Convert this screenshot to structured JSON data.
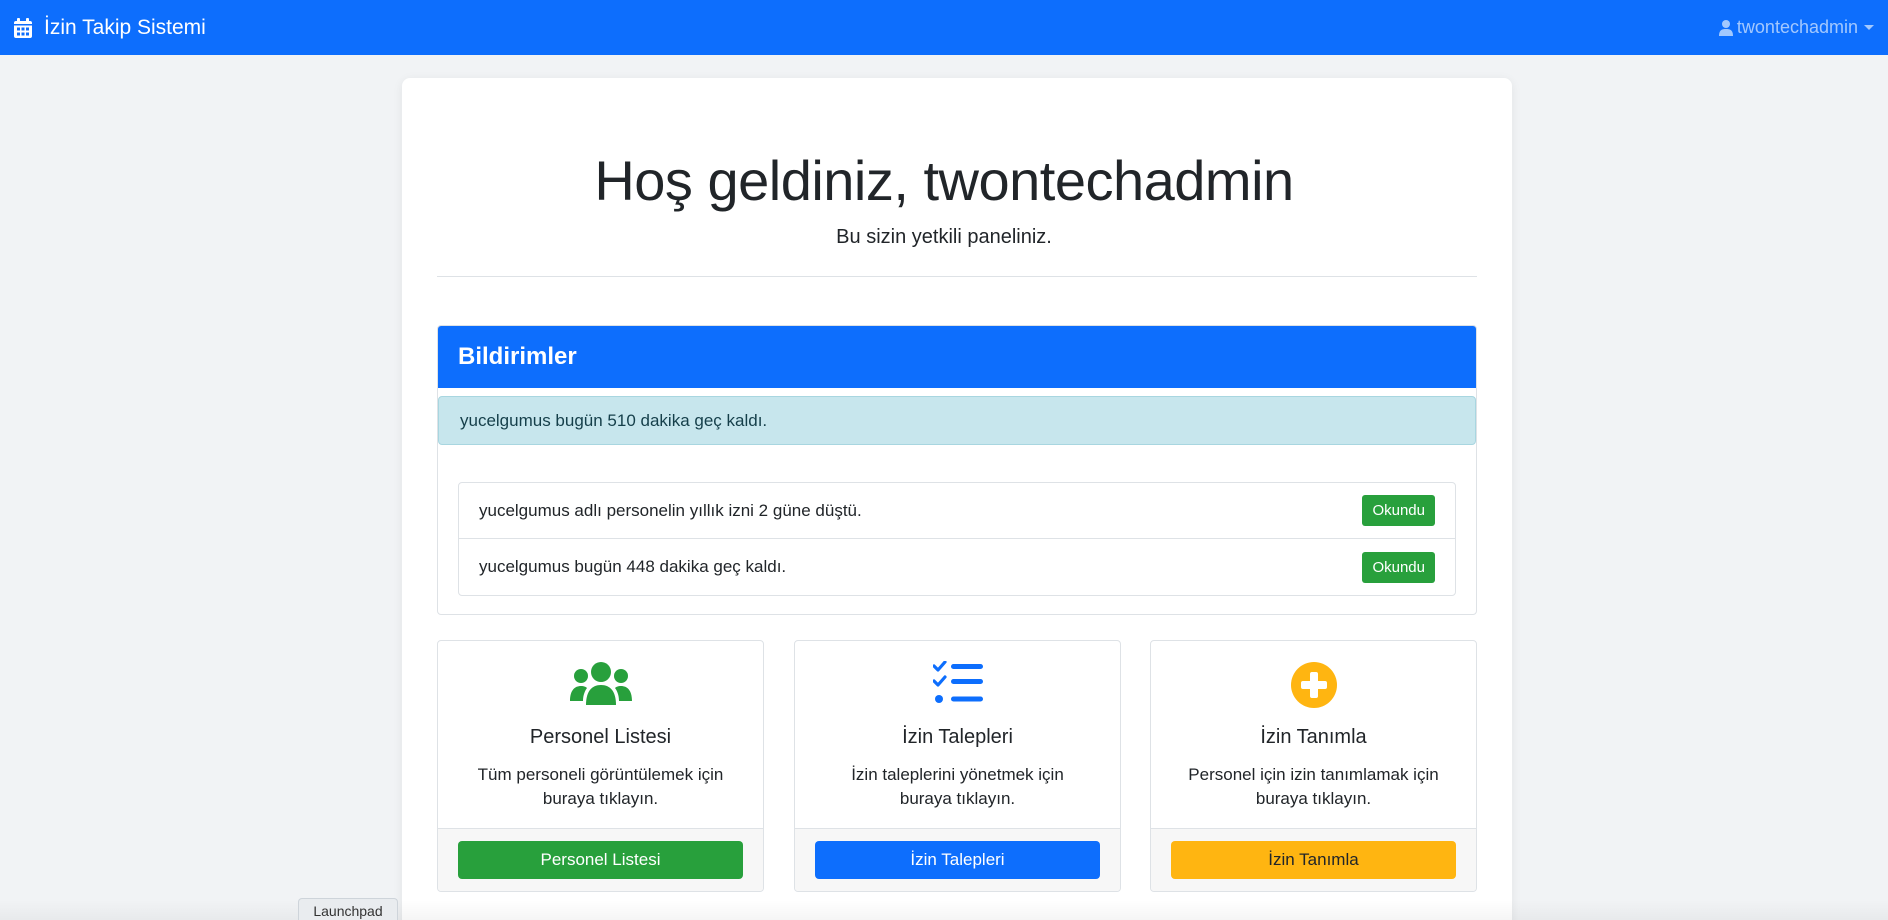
{
  "navbar": {
    "brand": "İzin Takip Sistemi",
    "brand_icon": "calendar-icon",
    "user": "twontechadmin",
    "user_icon": "user-icon"
  },
  "welcome": {
    "title": "Hoş geldiniz, twontechadmin",
    "subtitle": "Bu sizin yetkili paneliniz."
  },
  "notifications": {
    "header": "Bildirimler",
    "alert": "yucelgumus bugün 510 dakika geç kaldı.",
    "items": [
      {
        "text": "yucelgumus adlı personelin yıllık izni 2 güne düştü.",
        "button": "Okundu"
      },
      {
        "text": "yucelgumus bugün 448 dakika geç kaldı.",
        "button": "Okundu"
      }
    ]
  },
  "cards": [
    {
      "icon": "users-icon",
      "title": "Personel Listesi",
      "desc": "Tüm personeli görüntülemek için buraya tıklayın.",
      "button": "Personel Listesi",
      "color": "#28a03c"
    },
    {
      "icon": "list-check-icon",
      "title": "İzin Talepleri",
      "desc": "İzin taleplerini yönetmek için buraya tıklayın.",
      "button": "İzin Talepleri",
      "color": "#0d6efd"
    },
    {
      "icon": "plus-circle-icon",
      "title": "İzin Tanımla",
      "desc": "Personel için izin tanımlamak için buraya tıklayın.",
      "button": "İzin Tanımla",
      "color": "#ffb511"
    }
  ],
  "launchpad": "Launchpad"
}
